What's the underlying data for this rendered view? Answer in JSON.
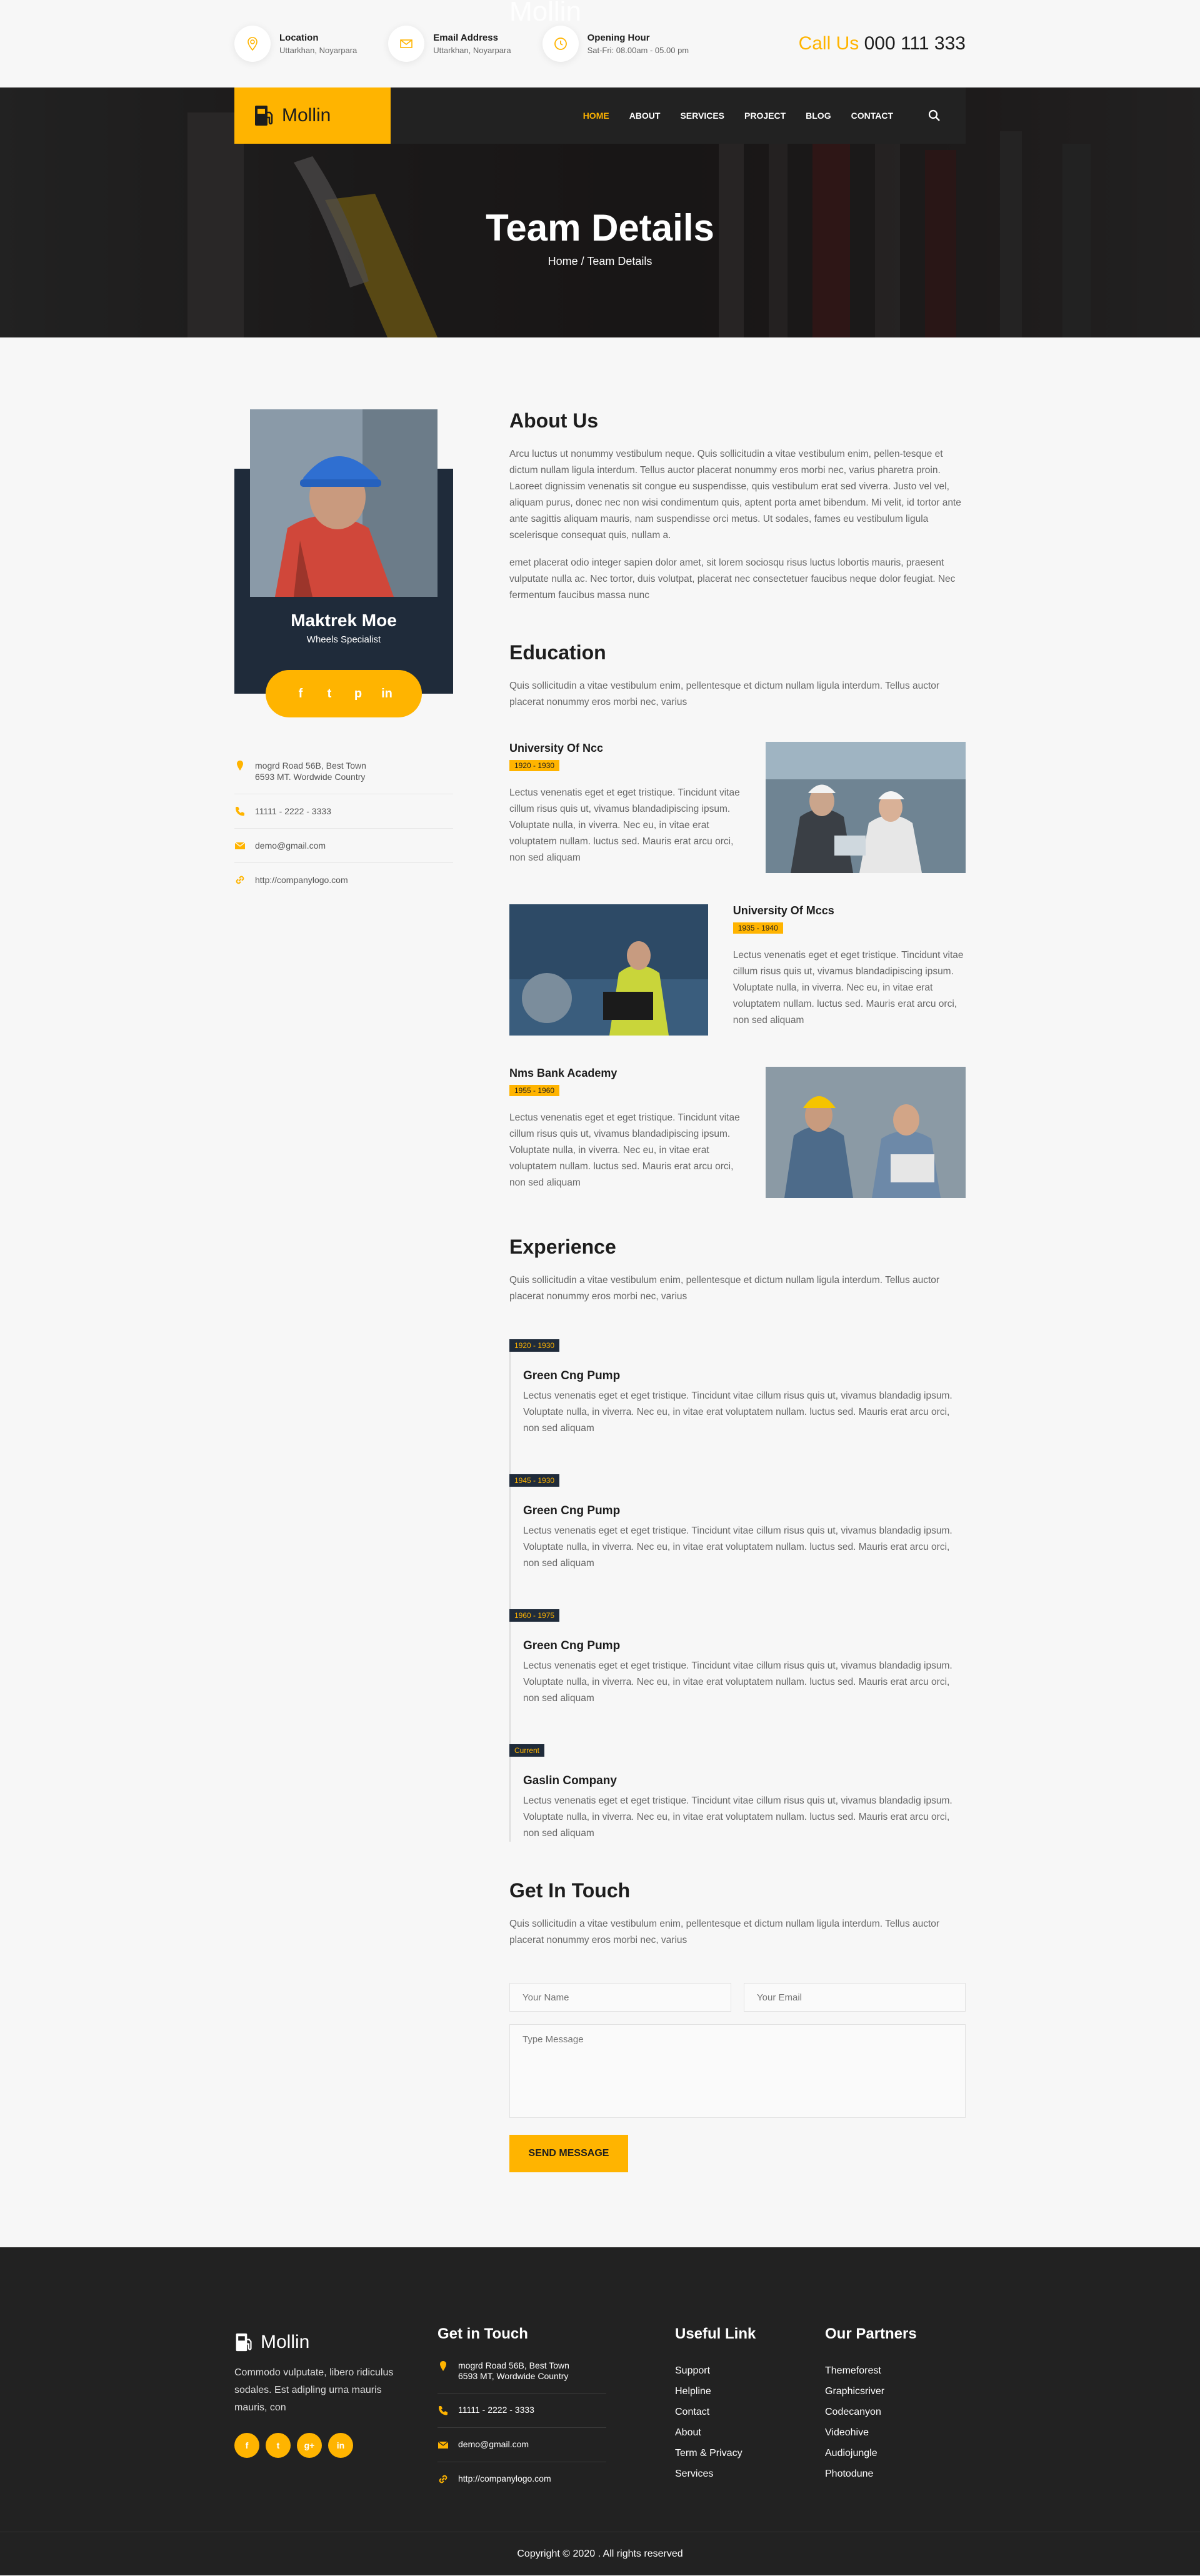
{
  "topbar": {
    "ghost_logo": "Mollin",
    "location_title": "Location",
    "location_text": "Uttarkhan, Noyarpara",
    "email_title": "Email Address",
    "email_text": "Uttarkhan, Noyarpara",
    "hours_title": "Opening Hour",
    "hours_text": "Sat-Fri: 08.00am - 05.00 pm",
    "call_label": "Call Us",
    "call_number": "000 111 333"
  },
  "nav": {
    "brand": "Mollin",
    "items": [
      "HOME",
      "ABOUT",
      "SERVICES",
      "PROJECT",
      "BLOG",
      "CONTACT"
    ],
    "active": "HOME"
  },
  "hero": {
    "title": "Team Details",
    "breadcrumb": "Home / Team Details"
  },
  "profile": {
    "name": "Maktrek Moe",
    "role": "Wheels Specialist",
    "social": [
      "f",
      "t",
      "p",
      "in"
    ],
    "address_line1": "mogrd Road 56B, Best Town",
    "address_line2": "6593 MT. Wordwide Country",
    "phone": "11111 - 2222 - 3333",
    "email": "demo@gmail.com",
    "website": "http://companylogo.com"
  },
  "about": {
    "title": "About Us",
    "p1": "Arcu luctus ut nonummy vestibulum neque. Quis sollicitudin a vitae vestibulum enim, pellen-tesque et dictum nullam ligula interdum. Tellus auctor placerat nonummy eros morbi nec, varius pharetra proin. Laoreet dignissim venenatis sit congue eu suspendisse, quis vestibulum erat sed viverra. Justo vel vel, aliquam purus, donec nec non wisi condimentum quis, aptent porta amet bibendum. Mi velit, id tortor ante ante sagittis aliquam mauris, nam suspendisse orci metus. Ut sodales, fames eu vestibulum ligula scelerisque consequat quis, nullam a.",
    "p2": "emet placerat odio integer sapien dolor amet, sit lorem sociosqu risus luctus lobortis mauris, praesent vulputate nulla ac. Nec tortor, duis volutpat, placerat nec consectetuer faucibus neque dolor feugiat. Nec fermentum faucibus massa nunc"
  },
  "education": {
    "title": "Education",
    "intro": "Quis sollicitudin a vitae vestibulum enim, pellentesque et dictum nullam ligula interdum. Tellus auctor placerat nonummy eros morbi nec, varius",
    "items": [
      {
        "school": "University Of Ncc",
        "years": "1920 - 1930",
        "text": "Lectus venenatis eget et eget tristique. Tincidunt vitae cillum risus quis ut, vivamus blandadipiscing ipsum. Voluptate nulla, in viverra. Nec eu, in vitae erat voluptatem nullam. luctus sed. Mauris erat arcu orci, non sed aliquam"
      },
      {
        "school": "University Of Mccs",
        "years": "1935 - 1940",
        "text": "Lectus venenatis eget et eget tristique. Tincidunt vitae cillum risus quis ut, vivamus blandadipiscing ipsum. Voluptate nulla, in viverra. Nec eu, in vitae erat voluptatem nullam. luctus sed. Mauris erat arcu orci, non sed aliquam"
      },
      {
        "school": "Nms Bank Academy",
        "years": "1955 - 1960",
        "text": "Lectus venenatis eget et eget tristique. Tincidunt vitae cillum risus quis ut, vivamus blandadipiscing ipsum. Voluptate nulla, in viverra. Nec eu, in vitae erat voluptatem nullam. luctus sed. Mauris erat arcu orci, non sed aliquam"
      }
    ]
  },
  "experience": {
    "title": "Experience",
    "intro": "Quis sollicitudin a vitae vestibulum enim, pellentesque et dictum nullam ligula interdum. Tellus auctor placerat nonummy eros morbi nec, varius",
    "items": [
      {
        "period": "1920 - 1930",
        "company": "Green Cng Pump",
        "text": "Lectus venenatis eget et eget tristique. Tincidunt vitae cillum risus quis ut, vivamus blandadig ipsum. Voluptate nulla, in viverra. Nec eu, in vitae erat voluptatem nullam. luctus sed. Mauris erat arcu orci, non sed aliquam"
      },
      {
        "period": "1945 - 1930",
        "company": "Green Cng Pump",
        "text": "Lectus venenatis eget et eget tristique. Tincidunt vitae cillum risus quis ut, vivamus blandadig ipsum. Voluptate nulla, in viverra. Nec eu, in vitae erat voluptatem nullam. luctus sed. Mauris erat arcu orci, non sed aliquam"
      },
      {
        "period": "1960 - 1975",
        "company": "Green Cng Pump",
        "text": "Lectus venenatis eget et eget tristique. Tincidunt vitae cillum risus quis ut, vivamus blandadig ipsum. Voluptate nulla, in viverra. Nec eu, in vitae erat voluptatem nullam. luctus sed. Mauris erat arcu orci, non sed aliquam"
      },
      {
        "period": "Current",
        "company": "Gaslin Company",
        "text": "Lectus venenatis eget et eget tristique. Tincidunt vitae cillum risus quis ut, vivamus blandadig ipsum. Voluptate nulla, in viverra. Nec eu, in vitae erat voluptatem nullam. luctus sed. Mauris erat arcu orci, non sed aliquam"
      }
    ]
  },
  "contact_form": {
    "title": "Get In Touch",
    "intro": "Quis sollicitudin a vitae vestibulum enim, pellentesque et dictum nullam ligula interdum. Tellus auctor placerat nonummy eros morbi nec, varius",
    "name_placeholder": "Your Name",
    "email_placeholder": "Your Email",
    "message_placeholder": "Type Message",
    "submit_label": "SEND MESSAGE"
  },
  "footer": {
    "brand": "Mollin",
    "description": "Commodo vulputate, libero ridiculus sodales. Est adipling urna mauris mauris, con",
    "social": [
      "f",
      "t",
      "g+",
      "in"
    ],
    "touch_title": "Get in Touch",
    "address_line1": "mogrd Road 56B, Best Town",
    "address_line2": "6593 MT, Wordwide Country",
    "phone": "11111 - 2222 - 3333",
    "email": "demo@gmail.com",
    "website": "http://companylogo.com",
    "useful_title": "Useful Link",
    "useful_links": [
      "Support",
      "Helpline",
      "Contact",
      "About",
      "Term & Privacy",
      "Services"
    ],
    "partners_title": "Our Partners",
    "partners": [
      "Themeforest",
      "Graphicsriver",
      "Codecanyon",
      "Videohive",
      "Audiojungle",
      "Photodune"
    ],
    "copyright": "Copyright © 2020 . All rights reserved"
  },
  "colors": {
    "accent": "#ffb400",
    "dark": "#222222",
    "navy": "#1f2b3a"
  }
}
